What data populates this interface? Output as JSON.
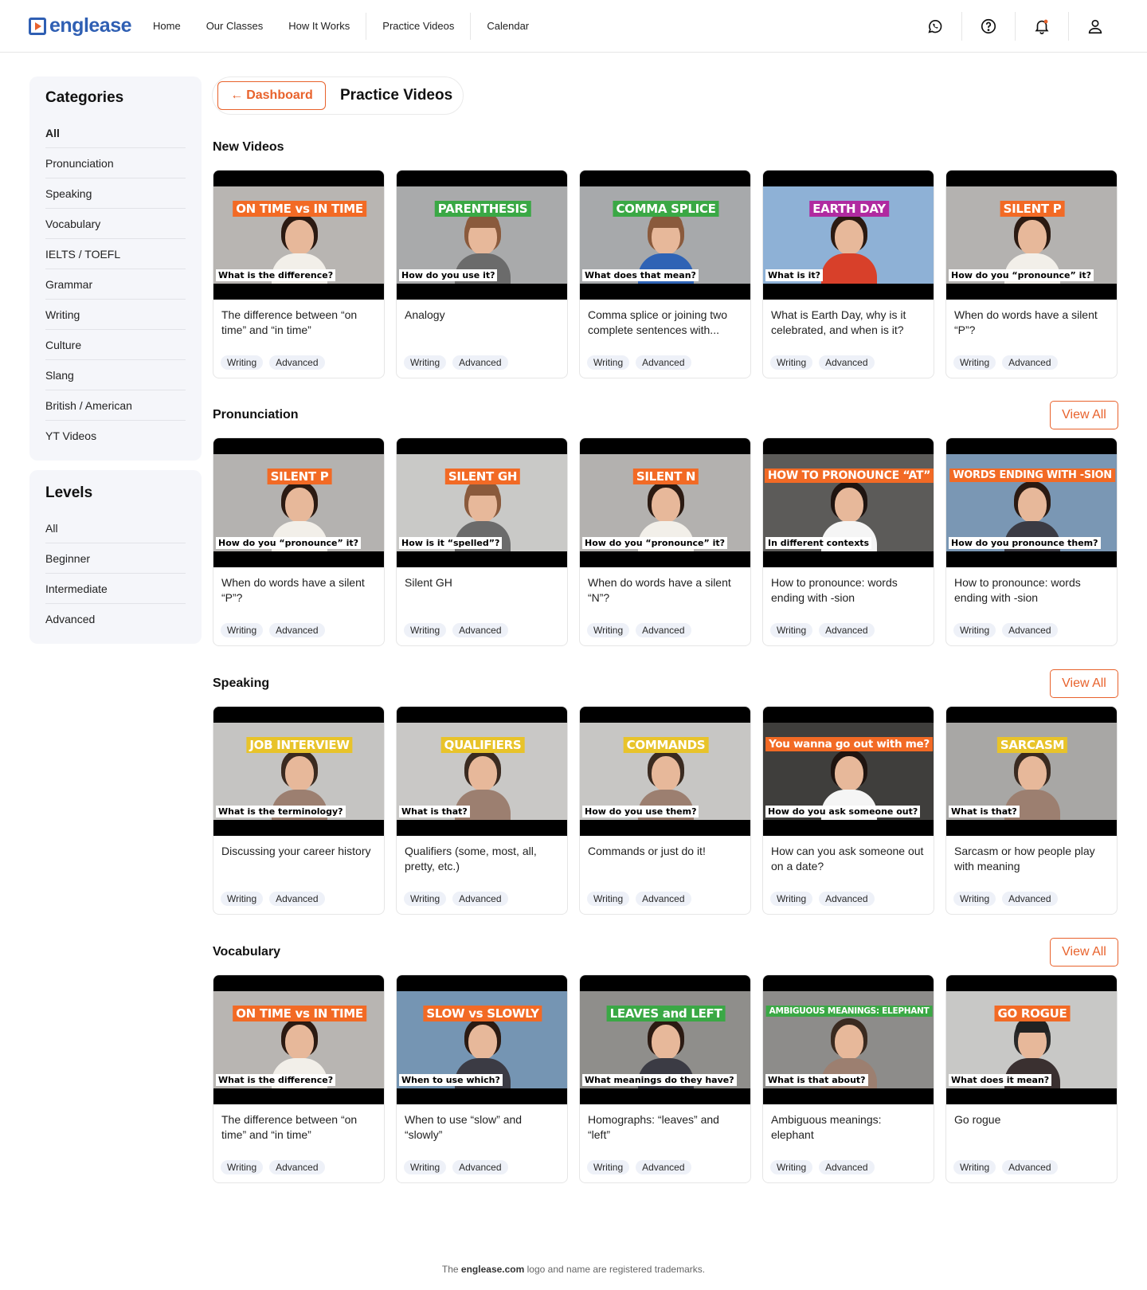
{
  "header": {
    "logo": "englease",
    "nav": [
      "Home",
      "Our Classes",
      "How It Works",
      "Practice Videos",
      "Calendar"
    ]
  },
  "sidebar": {
    "categories_title": "Categories",
    "categories": [
      "All",
      "Pronunciation",
      "Speaking",
      "Vocabulary",
      "IELTS / TOEFL",
      "Grammar",
      "Writing",
      "Culture",
      "Slang",
      "British / American",
      "YT Videos"
    ],
    "levels_title": "Levels",
    "levels": [
      "All",
      "Beginner",
      "Intermediate",
      "Advanced"
    ]
  },
  "breadcrumb": {
    "back_label": "Dashboard",
    "title": "Practice Videos"
  },
  "view_all_label": "View All",
  "sections": [
    {
      "title": "New Videos",
      "cards": [
        {
          "banner": "ON TIME vs IN TIME",
          "banner_color": "#f26a25",
          "question": "What is the difference?",
          "title": "The difference between “on time” and “in time”",
          "tags": [
            "Writing",
            "Advanced"
          ],
          "person": "woman",
          "bg": "#b8b5b2"
        },
        {
          "banner": "PARENTHESIS",
          "banner_color": "#3aa845",
          "question": "How do you use it?",
          "title": "Analogy",
          "tags": [
            "Writing",
            "Advanced"
          ],
          "person": "man-cap",
          "bg": "#a9aaab"
        },
        {
          "banner": "COMMA SPLICE",
          "banner_color": "#3aa845",
          "question": "What does that mean?",
          "title": "Comma splice or joining two complete sentences with...",
          "tags": [
            "Writing",
            "Advanced"
          ],
          "person": "man-cap-blue",
          "bg": "#a7a9ab"
        },
        {
          "banner": "EARTH DAY",
          "banner_color": "#b02aa0",
          "question": "What is it?",
          "title": "What is Earth Day, why is it celebrated, and when is it?",
          "tags": [
            "Writing",
            "Advanced"
          ],
          "person": "woman-red",
          "bg": "#8eb1d6"
        },
        {
          "banner": "SILENT P",
          "banner_color": "#f26a25",
          "question": "How do you “pronounce” it?",
          "title": "When do words have a silent “P”?",
          "tags": [
            "Writing",
            "Advanced"
          ],
          "person": "woman",
          "bg": "#b4b2b0"
        }
      ]
    },
    {
      "title": "Pronunciation",
      "cards": [
        {
          "banner": "SILENT P",
          "banner_color": "#f26a25",
          "question": "How do you “pronounce” it?",
          "title": "When do words have a silent “P”?",
          "tags": [
            "Writing",
            "Advanced"
          ],
          "person": "woman",
          "bg": "#b4b2b0"
        },
        {
          "banner": "SILENT GH",
          "banner_color": "#f26a25",
          "question": "How is it “spelled”?",
          "title": "Silent GH",
          "tags": [
            "Writing",
            "Advanced"
          ],
          "person": "man-cap",
          "bg": "#c9c9c7"
        },
        {
          "banner": "SILENT N",
          "banner_color": "#f26a25",
          "question": "How do you “pronounce” it?",
          "title": "When do words have a silent “N”?",
          "tags": [
            "Writing",
            "Advanced"
          ],
          "person": "woman",
          "bg": "#b3b1af"
        },
        {
          "banner": "HOW TO PRONOUNCE “AT”",
          "banner_color": "#f26a25",
          "question": "In different contexts",
          "title": "How to pronounce: words ending with -sion",
          "tags": [
            "Writing",
            "Advanced"
          ],
          "person": "woman-white",
          "bg": "#5c5b59"
        },
        {
          "banner": "WORDS ENDING WITH -SION",
          "banner_color": "#f26a25",
          "question": "How do you pronounce them?",
          "title": "How to pronounce: words ending with -sion",
          "tags": [
            "Writing",
            "Advanced"
          ],
          "person": "woman-dark",
          "bg": "#7a97b4"
        }
      ]
    },
    {
      "title": "Speaking",
      "cards": [
        {
          "banner": "JOB INTERVIEW",
          "banner_color": "#e8c32a",
          "question": "What is the terminology?",
          "title": "Discussing your career history",
          "tags": [
            "Writing",
            "Advanced"
          ],
          "person": "man",
          "bg": "#c5c4c2"
        },
        {
          "banner": "QUALIFIERS",
          "banner_color": "#e8c32a",
          "question": "What is that?",
          "title": "Qualifiers (some, most, all, pretty, etc.)",
          "tags": [
            "Writing",
            "Advanced"
          ],
          "person": "man",
          "bg": "#c9c8c6"
        },
        {
          "banner": "COMMANDS",
          "banner_color": "#e8c32a",
          "question": "How do you use them?",
          "title": "Commands or just do it!",
          "tags": [
            "Writing",
            "Advanced"
          ],
          "person": "man",
          "bg": "#c7c6c4"
        },
        {
          "banner": "You wanna go out with me?",
          "banner_color": "#f26a25",
          "question": "How do you ask someone out?",
          "title": "How can you ask someone out on a date?",
          "tags": [
            "Writing",
            "Advanced"
          ],
          "person": "woman-white",
          "bg": "#3f3e3c"
        },
        {
          "banner": "SARCASM",
          "banner_color": "#e8c32a",
          "question": "What is that?",
          "title": "Sarcasm or how people play with meaning",
          "tags": [
            "Writing",
            "Advanced"
          ],
          "person": "man",
          "bg": "#a8a7a5"
        }
      ]
    },
    {
      "title": "Vocabulary",
      "cards": [
        {
          "banner": "ON TIME vs IN TIME",
          "banner_color": "#f26a25",
          "question": "What is the difference?",
          "title": "The difference between “on time” and “in time”",
          "tags": [
            "Writing",
            "Advanced"
          ],
          "person": "woman",
          "bg": "#b8b5b2"
        },
        {
          "banner": "SLOW vs SLOWLY",
          "banner_color": "#f26a25",
          "question": "When to use which?",
          "title": "When to use “slow” and “slowly”",
          "tags": [
            "Writing",
            "Advanced"
          ],
          "person": "woman-dark",
          "bg": "#7595b3"
        },
        {
          "banner": "LEAVES and LEFT",
          "banner_color": "#3aa845",
          "question": "What meanings do they have?",
          "title": "Homographs: “leaves” and “left”",
          "tags": [
            "Writing",
            "Advanced"
          ],
          "person": "woman-dark",
          "bg": "#8f8e8b"
        },
        {
          "banner": "AMBIGUOUS MEANINGS: ELEPHANT",
          "banner_color": "#3aa845",
          "question": "What is that about?",
          "title": "Ambiguous meanings: elephant",
          "tags": [
            "Writing",
            "Advanced"
          ],
          "person": "man",
          "bg": "#8d8c8a"
        },
        {
          "banner": "GO ROGUE",
          "banner_color": "#f26a25",
          "question": "What does it mean?",
          "title": "Go rogue",
          "tags": [
            "Writing",
            "Advanced"
          ],
          "person": "man-cap-dark",
          "bg": "#c8c8c6"
        }
      ]
    }
  ],
  "footer": {
    "prefix": "The",
    "brand": "englease.com",
    "suffix": "logo and name are registered trademarks."
  }
}
